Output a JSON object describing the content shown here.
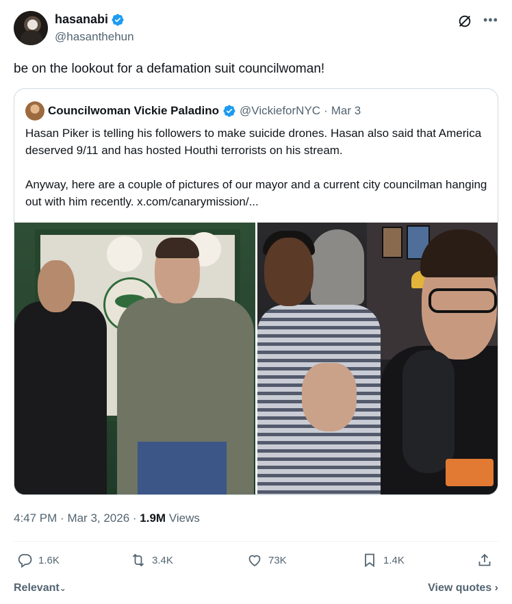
{
  "author": {
    "display_name": "hasanabi",
    "handle": "@hasanthehun"
  },
  "tweet": {
    "text": "be on the lookout for a defamation suit councilwoman!",
    "time": "4:47 PM",
    "date": "Mar 3, 2026",
    "views_count": "1.9M",
    "views_label": "Views"
  },
  "quoted": {
    "display_name": "Councilwoman Vickie Paladino",
    "handle": "@VickieforNYC",
    "separator": "·",
    "date": "Mar 3",
    "paragraph1": "Hasan Piker is telling his followers to make suicide drones. Hasan also said that America deserved 9/11 and has hosted Houthi terrorists on his stream.",
    "paragraph2": "Anyway, here are a couple of pictures of our mayor and a current city councilman hanging out with him recently.  x.com/canarymission/..."
  },
  "actions": {
    "replies": "1.6K",
    "reposts": "3.4K",
    "likes": "73K",
    "bookmarks": "1.4K"
  },
  "footer": {
    "sort_label": "Relevant",
    "view_quotes_label": "View quotes"
  },
  "colors": {
    "verified": "#1d9bf0",
    "secondary_text": "#536471",
    "primary_text": "#0f1419",
    "border": "#cfd9de"
  },
  "icons": [
    "verified-badge-icon",
    "grok-icon",
    "more-icon",
    "reply-icon",
    "repost-icon",
    "like-icon",
    "bookmark-icon",
    "share-icon",
    "chevron-down-icon",
    "chevron-right-icon"
  ]
}
